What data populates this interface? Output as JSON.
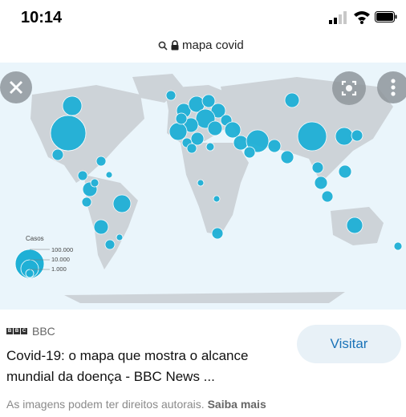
{
  "status_bar": {
    "time": "10:14"
  },
  "browser": {
    "url_text": "mapa covid"
  },
  "map": {
    "legend": {
      "title": "Casos",
      "labels": [
        "100.000",
        "10.000",
        "1.000"
      ]
    },
    "bubble_color": "#1fb0d6",
    "land_color": "#cdd3d8",
    "water_color": "#eaf5fb"
  },
  "result": {
    "source_logo": [
      "B",
      "B",
      "C"
    ],
    "source_name": "BBC",
    "title": "Covid-19: o mapa que mostra o alcance mundial da doença - BBC News ...",
    "visit_label": "Visitar",
    "copyright_text": "As imagens podem ter direitos autorais.",
    "learn_more": "Saiba mais"
  }
}
